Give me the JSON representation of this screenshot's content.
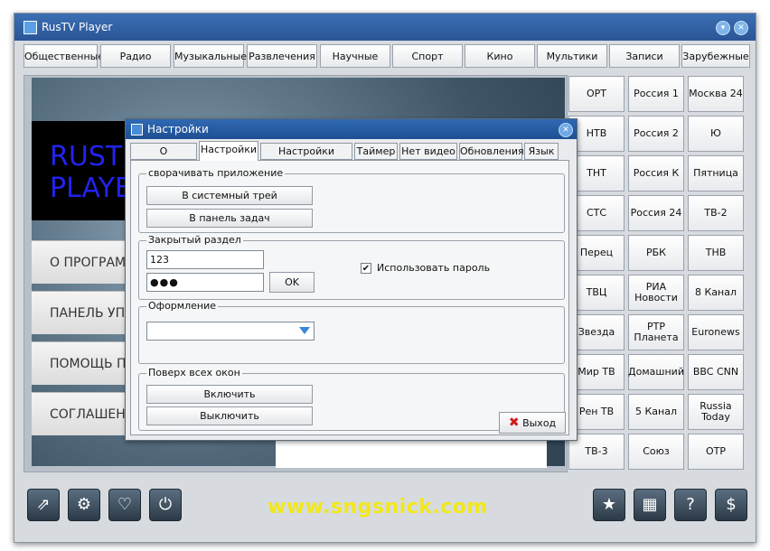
{
  "app": {
    "title": "RusTV Player",
    "watermark": "www.sngsnick.com"
  },
  "categories": [
    "Общественные",
    "Радио",
    "Музыкальные",
    "Развлечения",
    "Научные",
    "Спорт",
    "Кино",
    "Мультики",
    "Записи",
    "Зарубежные"
  ],
  "main": {
    "logo_line1": "RUST",
    "logo_line2": "PLAYE",
    "menu": [
      "О ПРОГРАММ",
      "ПАНЕЛЬ УПР",
      "ПОМОЩЬ ПР",
      "СОГЛАШЕНИ"
    ]
  },
  "channels": [
    "ОРТ",
    "Россия 1",
    "Москва 24",
    "НТВ",
    "Россия 2",
    "Ю",
    "ТНТ",
    "Россия К",
    "Пятница",
    "СТС",
    "Россия 24",
    "ТВ-2",
    "Перец",
    "РБК",
    "ТНВ",
    "ТВЦ",
    "РИА Новости",
    "8 Канал",
    "Звезда",
    "РТР Планета",
    "Euronews",
    "Мир ТВ",
    "Домашний",
    "BBC CNN",
    "Рен ТВ",
    "5 Канал",
    "Russia Today",
    "ТВ-3",
    "Союз",
    "ОТР"
  ],
  "bottom_icons": [
    "external-link-icon",
    "gear-icon",
    "heart-icon",
    "power-icon",
    "star-icon",
    "grid-icon",
    "help-icon",
    "dollar-icon"
  ],
  "dialog": {
    "title": "Настройки",
    "tabs": [
      "О программе",
      "Настройки",
      "Настройки прокси",
      "Таймер",
      "Нет видео",
      "Обновления",
      "Язык"
    ],
    "active_tab": "Настройки",
    "minimize_group": {
      "legend": "сворачивать приложение",
      "tray_button": "В системный трей",
      "taskbar_button": "В панель задач"
    },
    "closed_section": {
      "legend": "Закрытый раздел",
      "code_value": "123",
      "password_value": "●●●",
      "ok_button": "OK",
      "use_password_label": "Использовать пароль",
      "use_password_checked": true
    },
    "appearance": {
      "legend": "Оформление",
      "selected": ""
    },
    "on_top": {
      "legend": "Поверх всех окон",
      "enable_button": "Включить",
      "disable_button": "Выключить"
    },
    "exit_button": "Выход"
  }
}
